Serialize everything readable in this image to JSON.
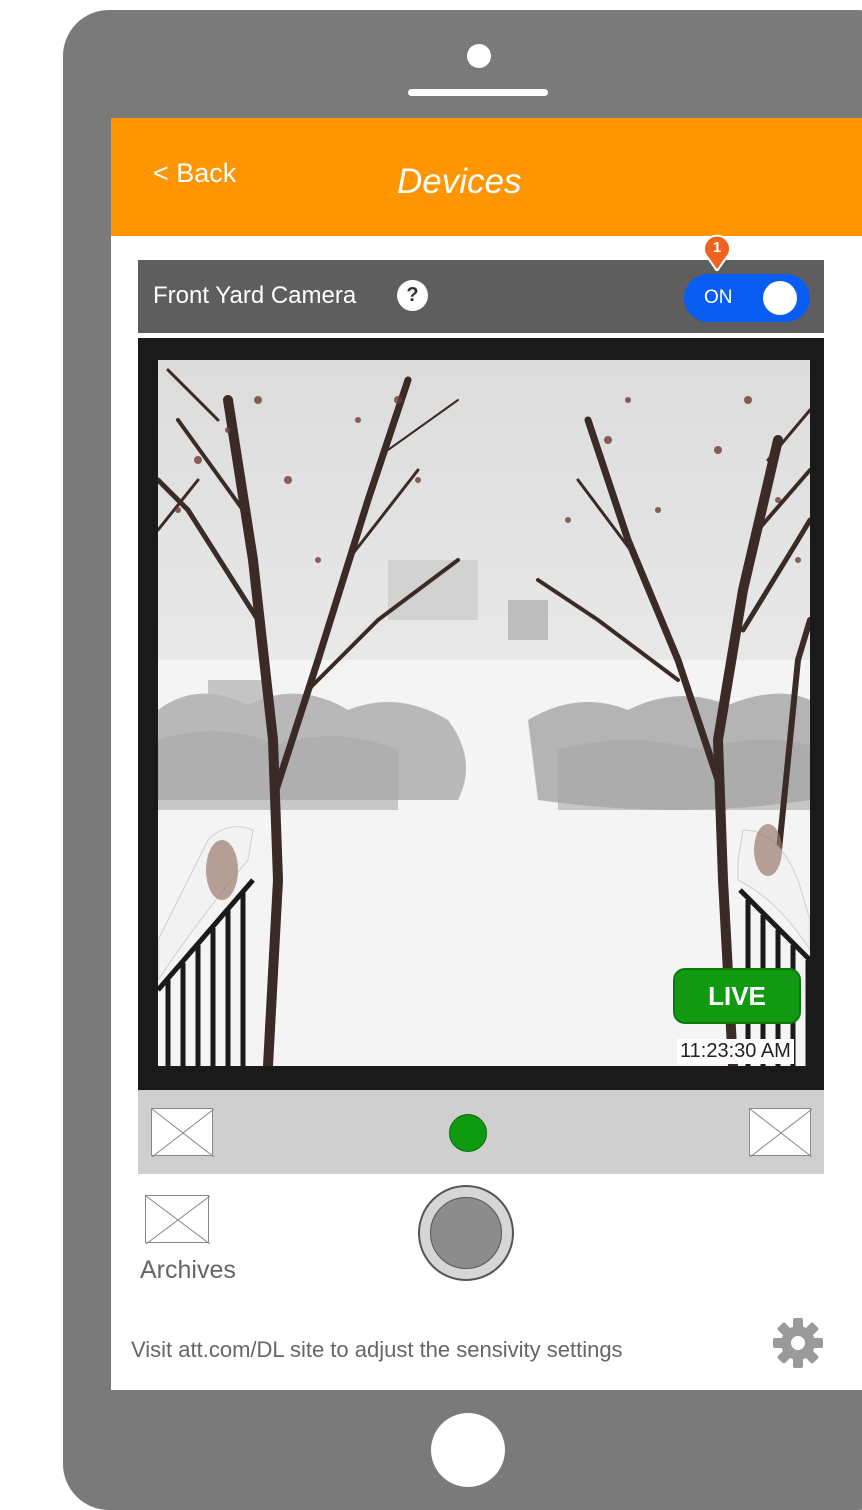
{
  "header": {
    "back_label": "< Back",
    "title": "Devices"
  },
  "camera": {
    "name": "Front Yard Camera",
    "help_label": "?",
    "toggle_label": "ON",
    "badge_count": "1"
  },
  "video": {
    "live_label": "LIVE",
    "timestamp": "11:23:30 AM"
  },
  "archives": {
    "label": "Archives"
  },
  "footer": {
    "text": "Visit att.com/DL site to adjust the sensivity settings"
  },
  "colors": {
    "header": "#ff9500",
    "toggle_on": "#0a5df2",
    "live": "#119a11",
    "badge": "#f0621e"
  }
}
